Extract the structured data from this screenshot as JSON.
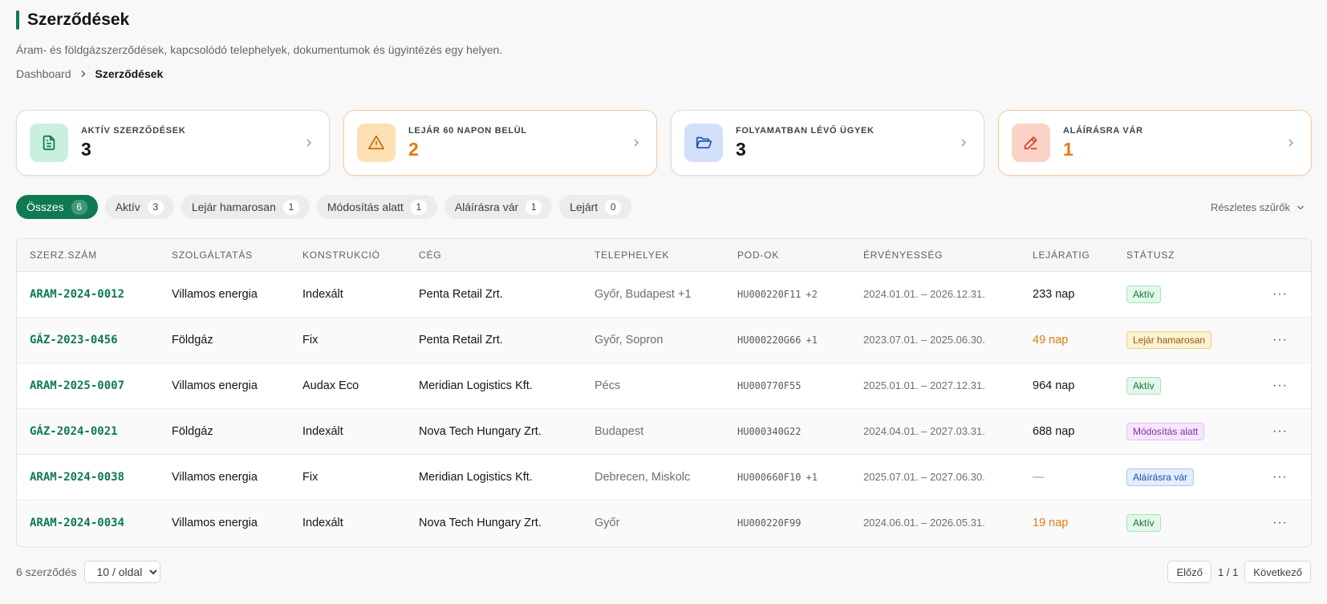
{
  "header": {
    "title": "Szerződések",
    "subtitle": "Áram- és földgázszerződések, kapcsolódó telephelyek, dokumentumok és ügyintézés egy helyen.",
    "breadcrumb": {
      "home": "Dashboard",
      "current": "Szerződések"
    }
  },
  "cards": [
    {
      "label": "AKTÍV SZERZŐDÉSEK",
      "value": "3",
      "icon": "document-icon",
      "color": "#0f6e4a"
    },
    {
      "label": "LEJÁR 60 NAPON BELÜL",
      "value": "2",
      "icon": "warning-icon",
      "color": "#e07b12"
    },
    {
      "label": "FOLYAMATBAN LÉVŐ ÜGYEK",
      "value": "3",
      "icon": "folder-open-icon",
      "color": "#1d4fb8"
    },
    {
      "label": "ALÁÍRÁSRA VÁR",
      "value": "1",
      "icon": "pen-icon",
      "color": "#e07b12"
    }
  ],
  "filters": {
    "chips": [
      {
        "label": "Összes",
        "count": "6"
      },
      {
        "label": "Aktív",
        "count": "3"
      },
      {
        "label": "Lejár hamarosan",
        "count": "1"
      },
      {
        "label": "Módosítás alatt",
        "count": "1"
      },
      {
        "label": "Aláírásra vár",
        "count": "1"
      },
      {
        "label": "Lejárt",
        "count": "0"
      }
    ],
    "advanced": "Részletes szűrők"
  },
  "table": {
    "columns": [
      "SZERZ.SZÁM",
      "SZOLGÁLTATÁS",
      "KONSTRUKCIÓ",
      "CÉG",
      "TELEPHELYEK",
      "POD-OK",
      "ÉRVÉNYESSÉG",
      "LEJÁRATIG",
      "STÁTUSZ"
    ],
    "rows": [
      {
        "id": "ARAM-2024-0012",
        "service": "Villamos energia",
        "construction": "Indexált",
        "company": "Penta Retail Zrt.",
        "sites": "Győr, Budapest +1",
        "pod": "HU000220F11",
        "pod_extra": "+2",
        "validity": "2024.01.01. – 2026.12.31.",
        "expiry": "233 nap",
        "status": "Aktív"
      },
      {
        "id": "GÁZ-2023-0456",
        "service": "Földgáz",
        "construction": "Fix",
        "company": "Penta Retail Zrt.",
        "sites": "Győr, Sopron",
        "pod": "HU000220G66",
        "pod_extra": "+1",
        "validity": "2023.07.01. – 2025.06.30.",
        "expiry": "49 nap",
        "status": "Lejár hamarosan"
      },
      {
        "id": "ARAM-2025-0007",
        "service": "Villamos energia",
        "construction": "Audax Eco",
        "company": "Meridian Logistics Kft.",
        "sites": "Pécs",
        "pod": "HU000770F55",
        "pod_extra": "",
        "validity": "2025.01.01. – 2027.12.31.",
        "expiry": "964 nap",
        "status": "Aktív"
      },
      {
        "id": "GÁZ-2024-0021",
        "service": "Földgáz",
        "construction": "Indexált",
        "company": "Nova Tech Hungary Zrt.",
        "sites": "Budapest",
        "pod": "HU000340G22",
        "pod_extra": "",
        "validity": "2024.04.01. – 2027.03.31.",
        "expiry": "688 nap",
        "status": "Módosítás alatt"
      },
      {
        "id": "ARAM-2024-0038",
        "service": "Villamos energia",
        "construction": "Fix",
        "company": "Meridian Logistics Kft.",
        "sites": "Debrecen, Miskolc",
        "pod": "HU000660F10",
        "pod_extra": "+1",
        "validity": "2025.07.01. – 2027.06.30.",
        "expiry": "—",
        "status": "Aláírásra vár"
      },
      {
        "id": "ARAM-2024-0034",
        "service": "Villamos energia",
        "construction": "Indexált",
        "company": "Nova Tech Hungary Zrt.",
        "sites": "Győr",
        "pod": "HU000220F99",
        "pod_extra": "",
        "validity": "2024.06.01. – 2026.05.31.",
        "expiry": "19 nap",
        "status": "Aktív"
      }
    ]
  },
  "footer": {
    "count": "6 szerződés",
    "per_page": "10 / oldal",
    "prev": "Előző",
    "page": "1 / 1",
    "next": "Következő"
  },
  "colors": {
    "accent": "#0f7a52",
    "warning": "#e07b12"
  }
}
